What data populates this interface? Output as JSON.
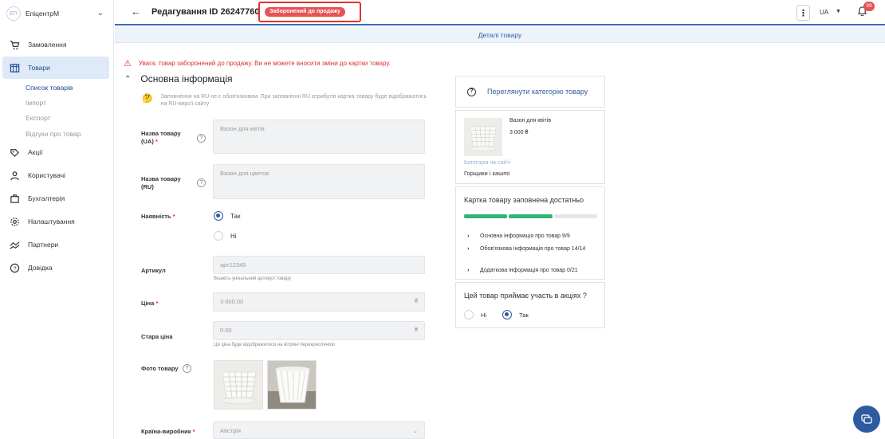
{
  "sidebar": {
    "logo_text": "ЕП",
    "store_name": "ЕпіцентрМ",
    "items": [
      {
        "label": "Замовлення"
      },
      {
        "label": "Товари"
      },
      {
        "label": "Акції"
      },
      {
        "label": "Користувачі"
      },
      {
        "label": "Бухгалтерія"
      },
      {
        "label": "Налаштування"
      },
      {
        "label": "Партнери"
      },
      {
        "label": "Довідка"
      }
    ],
    "subitems": [
      {
        "label": "Список товарів"
      },
      {
        "label": "Імпорт"
      },
      {
        "label": "Експорт"
      },
      {
        "label": "Відгуки про товар"
      }
    ]
  },
  "header": {
    "title": "Редагування ID 26247760",
    "status_badge": "Заборонений до продажу",
    "language": "UA",
    "notifications_count": "99"
  },
  "tab": {
    "label": "Деталі товару"
  },
  "warning": "Увага: товар заборонений до продажу. Ви не можете вносити зміни до картки товару.",
  "section_title": "Основна інформація",
  "note": "Заповнення на RU не є обов'язковим. При заповненні RU атрибутів картка товару буде відображатись на RU-версії сайту",
  "form": {
    "name_ua": {
      "label": "Назва товару (UA)",
      "required": "*",
      "value": "Вазон для квітів"
    },
    "name_ru": {
      "label": "Назва товару (RU)",
      "value": "Вазон для цветов"
    },
    "availability": {
      "label": "Наявність",
      "required": "*",
      "options": [
        "Так",
        "Ні"
      ],
      "selected": "Так"
    },
    "sku": {
      "label": "Артикул",
      "value": "арт12345",
      "hint": "Вкажіть унікальний артикул товару"
    },
    "price": {
      "label": "Ціна",
      "required": "*",
      "value": "3 000.00",
      "currency": "₴"
    },
    "old_price": {
      "label": "Стара ціна",
      "value": "0.00",
      "currency": "₴",
      "hint": "Ця ціна буде відображатися на вітрині перекресленою"
    },
    "photo": {
      "label": "Фото товару"
    },
    "country": {
      "label": "Країна-виробник",
      "required": "*",
      "value": "Австрія"
    }
  },
  "right": {
    "category_link": "Переглянути категорію товару",
    "product": {
      "name": "Вазон для квітів",
      "price": "3 000 ₴",
      "category_label": "Категорія на сайті",
      "category_value": "Горщики і кашпо"
    },
    "fill": {
      "title": "Картка товару заповнена достатньо",
      "rows": [
        "Основна інформація про товар 9/9",
        "Обов'язкова інформація про товар 14/14",
        "Додаткова інформація про товар 0/21"
      ],
      "progress": [
        1,
        1,
        0
      ]
    },
    "promo": {
      "title": "Цей товар приймає участь в акціях ?",
      "options": [
        "Ні",
        "Так"
      ],
      "selected": "Так"
    }
  },
  "colors": {
    "accent": "#2e5ba0",
    "danger": "#d93030",
    "badge": "#e55355",
    "progress_done": "#2fb575",
    "progress_empty": "#e3e6ea"
  },
  "icons": [
    "cart-icon",
    "products-icon",
    "promo-icon",
    "users-icon",
    "accounting-icon",
    "settings-icon",
    "partners-icon",
    "help-icon",
    "warning-icon",
    "bell-icon",
    "chat-icon"
  ]
}
